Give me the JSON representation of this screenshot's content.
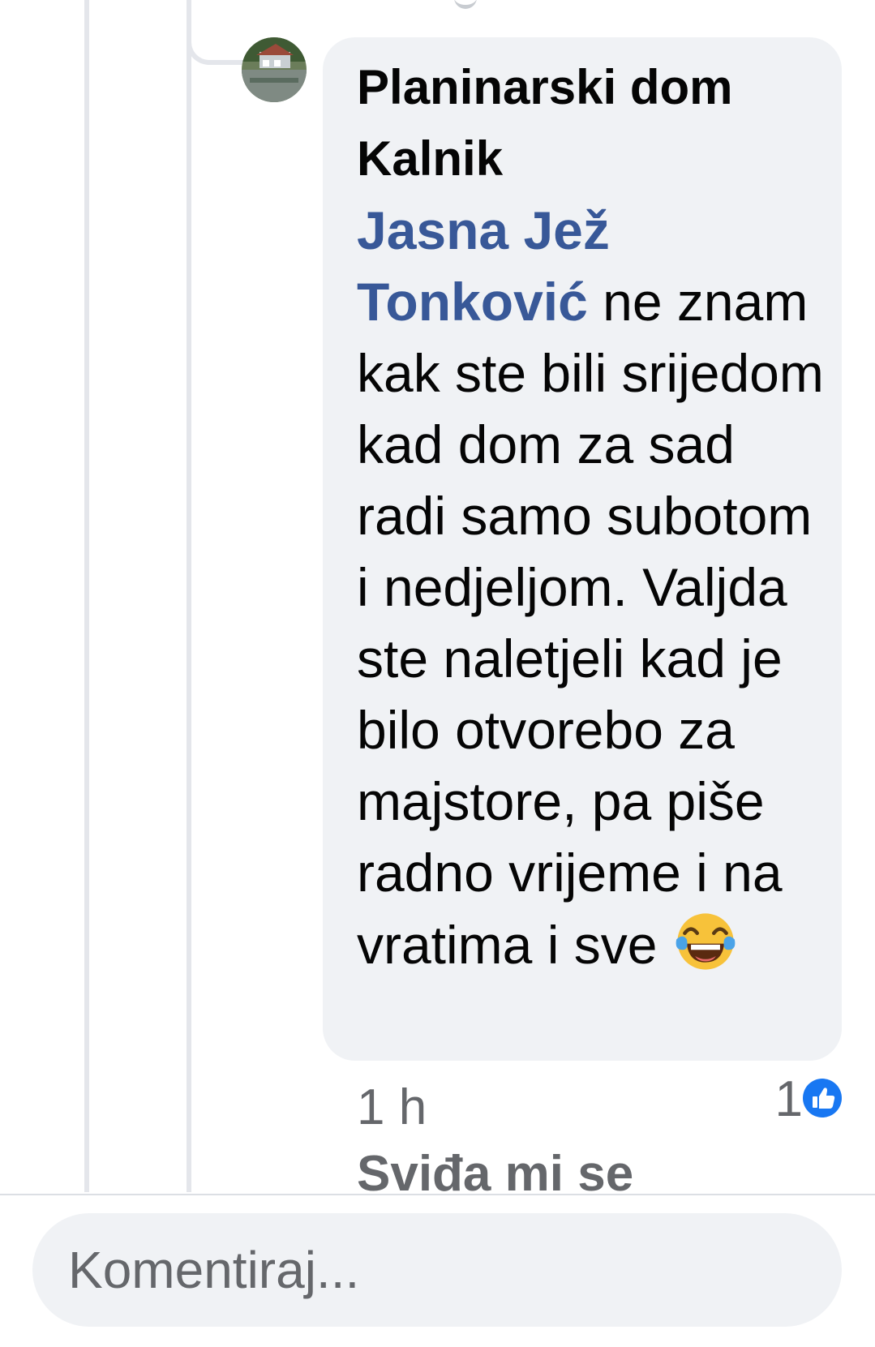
{
  "comment": {
    "author": "Planinarski dom Kalnik",
    "mention": "Jasna Jež Tonković",
    "text": " ne znam kak ste bili srijedom kad dom za sad radi samo subotom i nedjeljom. Valjda ste naletjeli kad je bilo otvorebo za majstore, pa piše radno vrijeme i na vratima i sve ",
    "emoji": "laughing-tears-emoji",
    "timestamp": "1 h",
    "like_count": "1",
    "like_action": "Sviđa mi se"
  },
  "composer": {
    "placeholder": "Komentiraj..."
  },
  "colors": {
    "mention": "#385898",
    "bubble": "#f0f2f5",
    "like_blue": "#1877f2",
    "secondary_text": "#65676b"
  }
}
